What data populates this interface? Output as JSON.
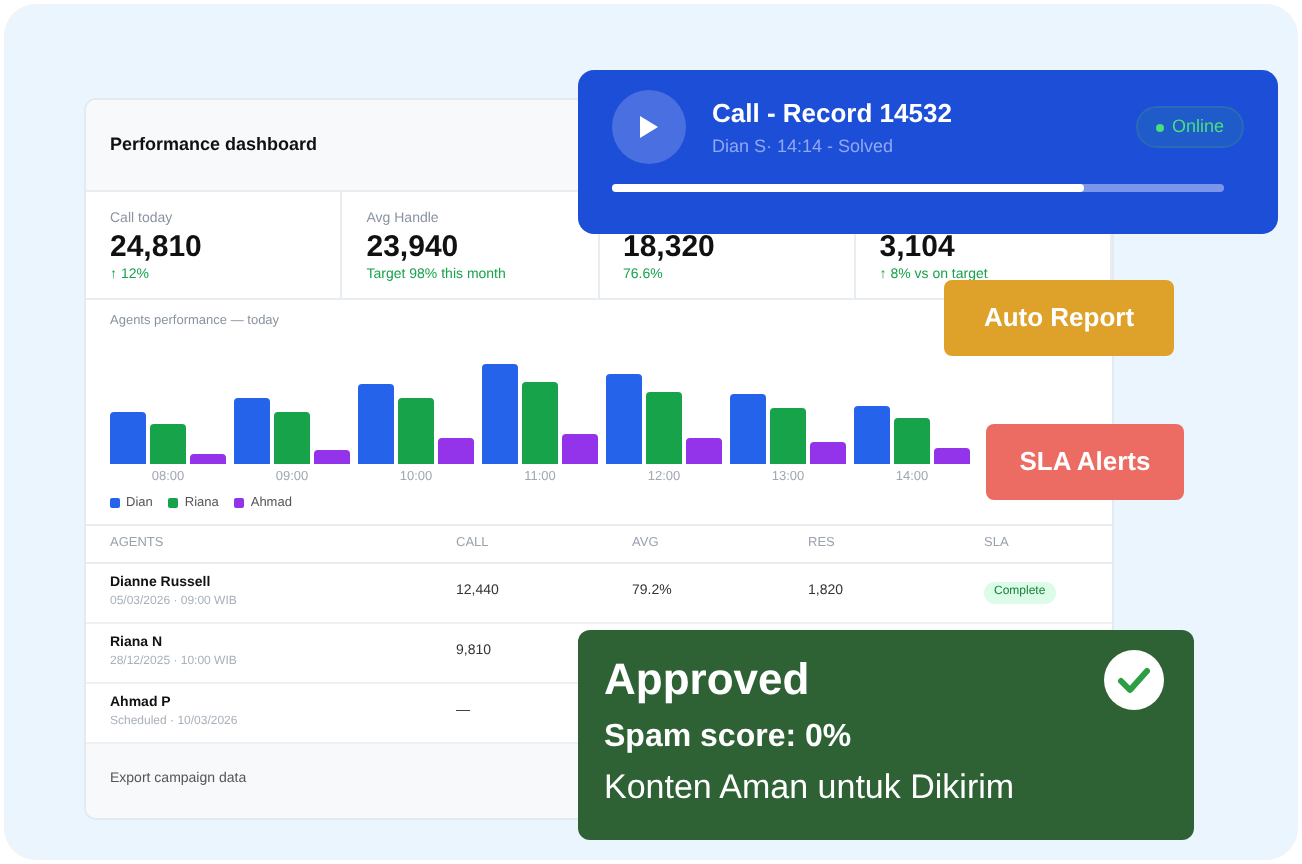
{
  "dashboard": {
    "title": "Performance dashboard",
    "stats": [
      {
        "label": "Call today",
        "value": "24,810",
        "note": "↑ 12%"
      },
      {
        "label": "Avg Handle",
        "value": "23,940",
        "note": "Target 98% this month"
      },
      {
        "value": "18,320",
        "note": "76.6%"
      },
      {
        "value": "3,104",
        "note": "↑ 8% vs on target"
      }
    ],
    "chart": {
      "title": "Agents performance — today",
      "categories": [
        "08:00",
        "09:00",
        "10:00",
        "11:00",
        "12:00",
        "13:00",
        "14:00"
      ],
      "legend": [
        {
          "name": "Dian",
          "color": "#2563eb"
        },
        {
          "name": "Riana",
          "color": "#16a34a"
        },
        {
          "name": "Ahmad",
          "color": "#9333ea"
        }
      ]
    },
    "table": {
      "columns": [
        "AGENTS",
        "CALL",
        "AVG",
        "RES",
        "SLA"
      ],
      "rows": [
        {
          "agent": "Dianne Russell",
          "agent_detail": "05/03/2026 · 09:00 WIB",
          "call": "12,440",
          "avg": "79.2%",
          "res": "1,820",
          "sla": "Complete"
        },
        {
          "agent": "Riana N",
          "agent_detail": "28/12/2025 · 10:00 WIB",
          "call": "9,810"
        },
        {
          "agent": "Ahmad P",
          "agent_detail": "Scheduled · 10/03/2026",
          "call": "—"
        }
      ]
    },
    "footer": "Export campaign data"
  },
  "call_card": {
    "title": "Call - Record 14532",
    "subtitle": "Dian S· 14:14 - Solved",
    "status": "Online",
    "level": 0.77
  },
  "auto_report": "Auto Report",
  "sla_alerts": "SLA Alerts",
  "approval": {
    "title": "Approved",
    "score": "Spam score: 0%",
    "message": "Konten Aman untuk Dikirim"
  }
}
